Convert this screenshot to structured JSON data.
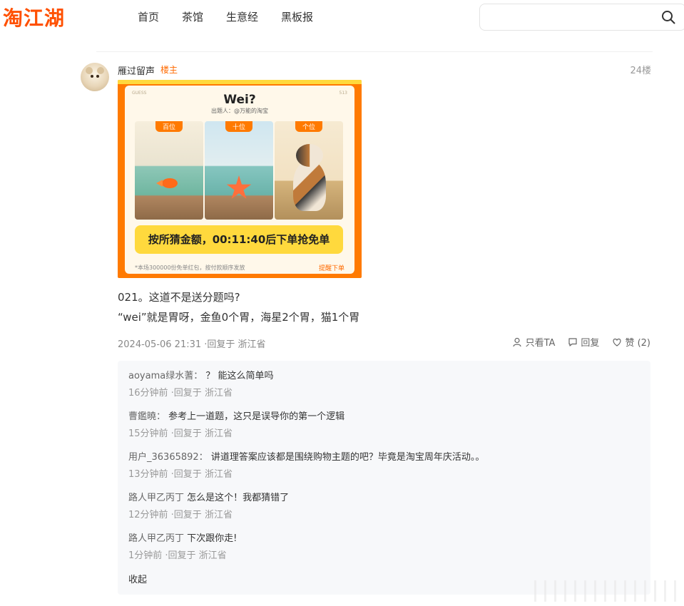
{
  "header": {
    "logo": "淘江湖",
    "nav": [
      "首页",
      "茶馆",
      "生意经",
      "黑板报"
    ],
    "search_placeholder": ""
  },
  "post": {
    "username": "雁过留声",
    "owner_badge": "楼主",
    "floor": "24楼",
    "image": {
      "corner_left": "GUESS",
      "corner_right": "513",
      "title": "Wei?",
      "subtitle": "出题人：@万能的淘宝",
      "tags": [
        "百位",
        "十位",
        "个位"
      ],
      "button": "按所猜金额，00:11:40后下单抢免单",
      "footer_left": "*本场300000份免单红包，按付款顺序发放",
      "footer_right": "提醒下单"
    },
    "body_line1": "021。这道不是送分题吗?",
    "body_line2": "“wei”就是胃呀，金鱼0个胃，海星2个胃，猫1个胃",
    "meta": "2024-05-06 21:31 ·回复于 浙江省",
    "actions": {
      "only_ta": "只看TA",
      "reply": "回复",
      "like": "赞 (2)"
    }
  },
  "replies": [
    {
      "user": "aoyama绿水蓍：",
      "text": "？ 能这么简单吗",
      "meta": "16分钟前 ·回复于 浙江省"
    },
    {
      "user": "曹鑑曉：",
      "text": "参考上一道题，这只是误导你的第一个逻辑",
      "meta": "15分钟前 ·回复于 浙江省"
    },
    {
      "user": "用户_36365892：",
      "text": "讲道理答案应该都是围绕购物主题的吧？毕竟是淘宝周年庆活动。。",
      "meta": "13分钟前 ·回复于 浙江省"
    },
    {
      "user": "路人甲乙丙丁",
      "text": "怎么是这个！我都猜错了",
      "meta": "12分钟前 ·回复于 浙江省"
    },
    {
      "user": "路人甲乙丙丁",
      "text": "下次跟你走!",
      "meta": "1分钟前 ·回复于 浙江省"
    }
  ],
  "collapse_label": "收起",
  "colors": {
    "brand": "#ff5000",
    "badge": "#ff6a00",
    "reply_bg": "#f7f8fa"
  }
}
